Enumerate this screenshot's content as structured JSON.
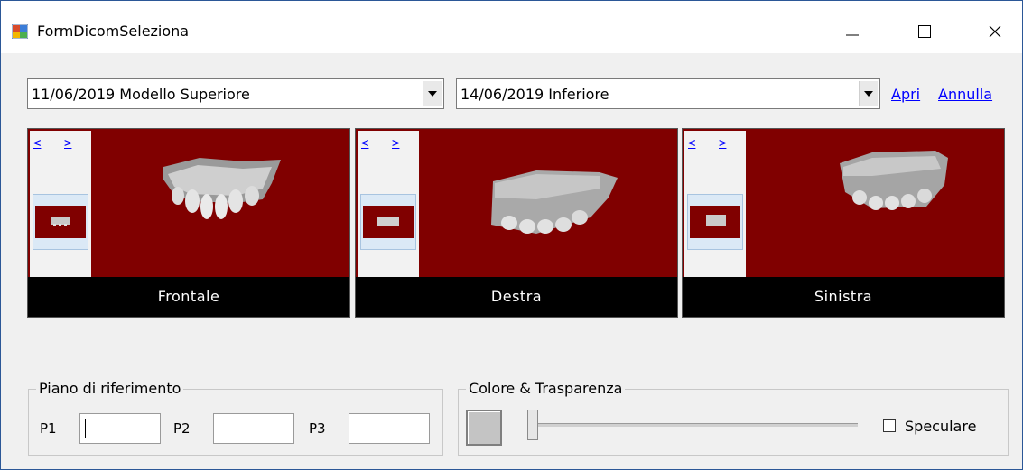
{
  "window": {
    "title": "FormDicomSeleziona"
  },
  "selectors": {
    "upper": "11/06/2019 Modello Superiore",
    "lower": "14/06/2019 Inferiore"
  },
  "actions": {
    "open": "Apri",
    "cancel": "Annulla"
  },
  "views": [
    {
      "caption": "Frontale",
      "prev": "<",
      "next": ">"
    },
    {
      "caption": "Destra",
      "prev": "<",
      "next": ">"
    },
    {
      "caption": "Sinistra",
      "prev": "<",
      "next": ">"
    }
  ],
  "reference_plane": {
    "legend": "Piano di riferimento",
    "p1_label": "P1",
    "p2_label": "P2",
    "p3_label": "P3",
    "p1_value": "",
    "p2_value": "",
    "p3_value": ""
  },
  "color_transparency": {
    "legend": "Colore & Trasparenza",
    "swatch_color": "#c4c4c4",
    "transparency": 0,
    "specular_label": "Speculare",
    "specular_checked": false
  },
  "colors": {
    "viewport_bg": "#800000",
    "caption_bg": "#000000",
    "link": "#0000ff"
  }
}
